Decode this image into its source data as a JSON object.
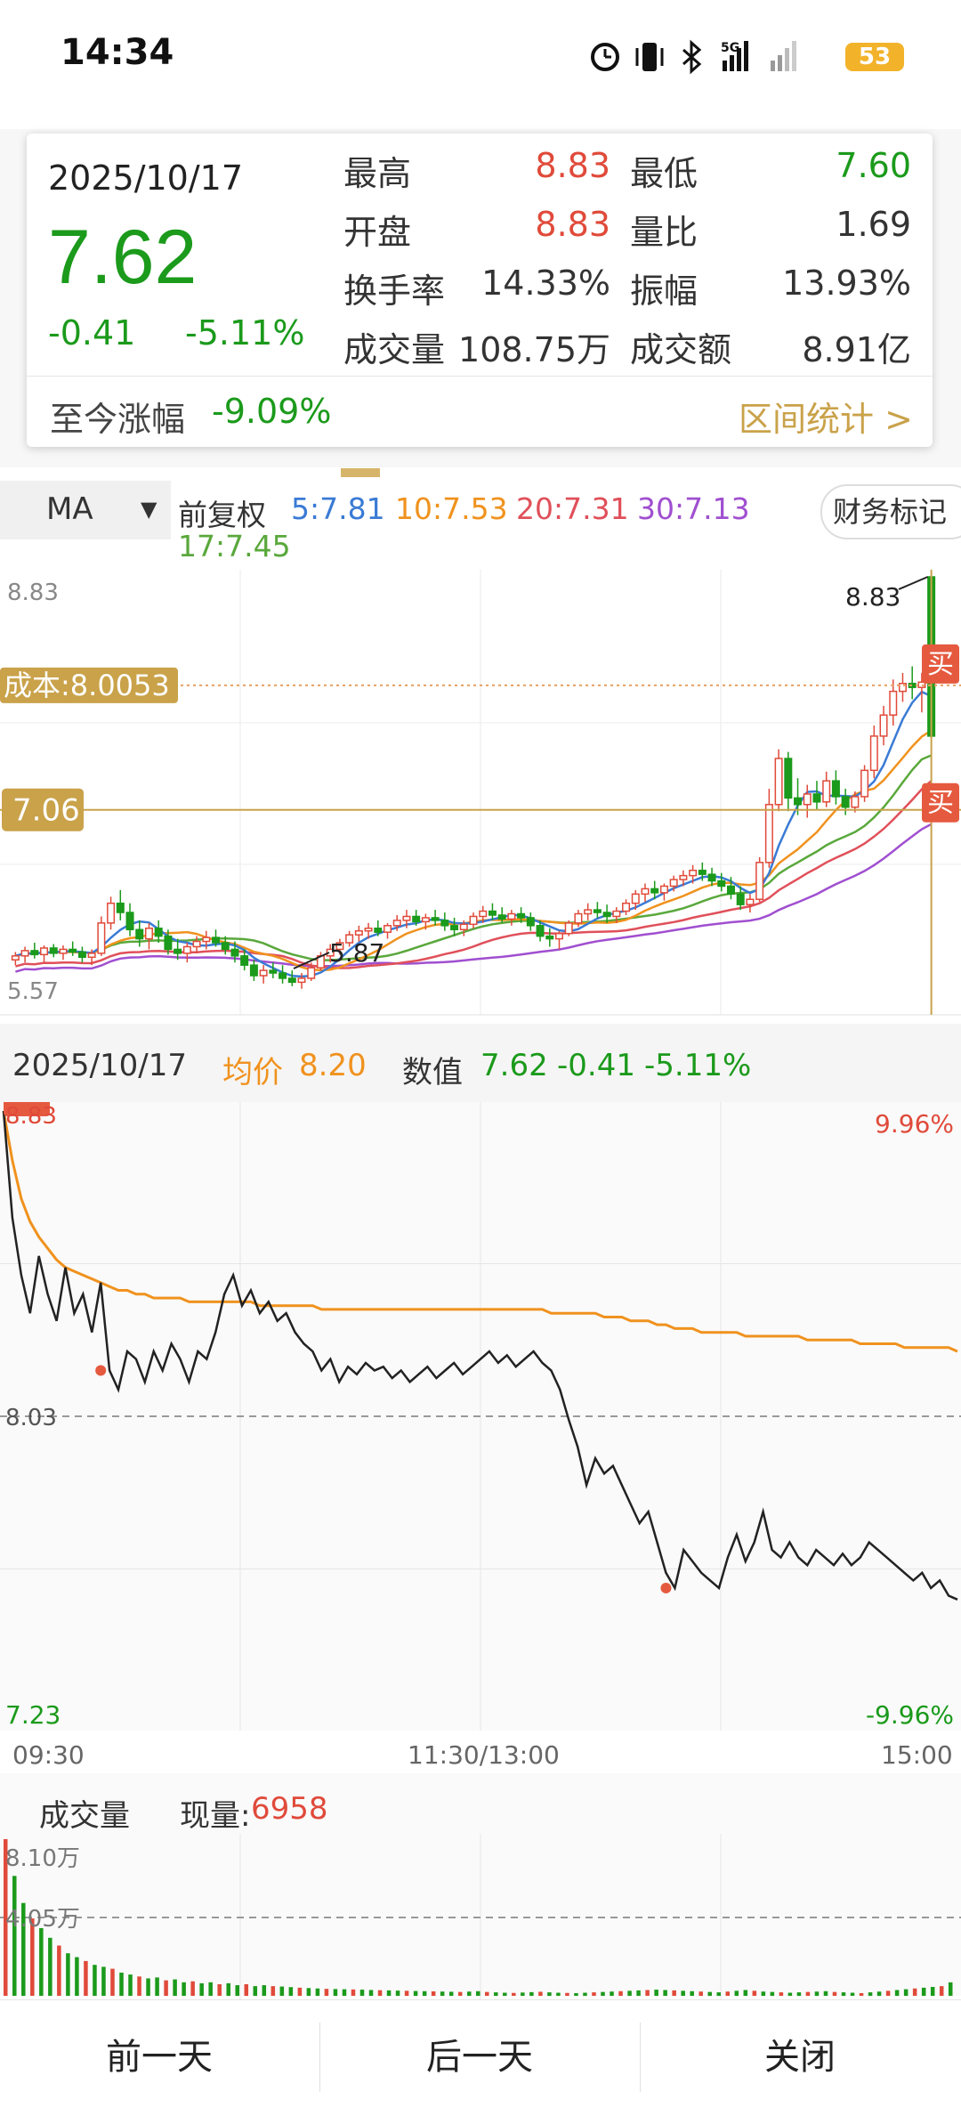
{
  "status_bar": {
    "time": "14:34",
    "battery": "53",
    "icons": [
      "alarm-icon",
      "vibrate-icon",
      "bluetooth-icon",
      "5g-signal-icon",
      "signal-icon",
      "battery-icon"
    ]
  },
  "popup": {
    "date": "2025/10/17",
    "price": "7.62",
    "change": "-0.41",
    "change_pct": "-5.11%",
    "stats": [
      {
        "label": "最高",
        "value": "8.83",
        "color": "#e04a3a"
      },
      {
        "label": "最低",
        "value": "7.60",
        "color": "#1b9a1b"
      },
      {
        "label": "开盘",
        "value": "8.83",
        "color": "#e04a3a"
      },
      {
        "label": "量比",
        "value": "1.69",
        "color": "#333333"
      },
      {
        "label": "换手率",
        "value": "14.33%",
        "color": "#333333"
      },
      {
        "label": "振幅",
        "value": "13.93%",
        "color": "#333333"
      },
      {
        "label": "成交量",
        "value": "108.75万",
        "color": "#333333"
      },
      {
        "label": "成交额",
        "value": "8.91亿",
        "color": "#333333"
      }
    ],
    "ytd_label": "至今涨幅",
    "ytd_value": "-9.09%",
    "range_stats": "区间统计 >"
  },
  "ma_bar": {
    "selector": "MA",
    "adjust": "前复权",
    "items": [
      {
        "text": "5:7.81",
        "color": "#3a7bd5"
      },
      {
        "text": "10:7.53",
        "color": "#f0921e"
      },
      {
        "text": "20:7.31",
        "color": "#e0505a"
      },
      {
        "text": "30:7.13",
        "color": "#a04fd0"
      },
      {
        "text": "17:7.45",
        "color": "#5aa83c"
      }
    ],
    "finance_mark": "财务标记"
  },
  "chart_data": [
    {
      "type": "candlestick",
      "title": "",
      "y_labels": {
        "top": "8.83",
        "bottom": "5.57"
      },
      "ylim": [
        5.57,
        8.83
      ],
      "high_marker": "8.83",
      "low_marker": "5.87",
      "cost_line": {
        "label": "成本:8.0053",
        "value": 8.0053
      },
      "price_line": {
        "label": "7.06",
        "value": 7.06
      },
      "buy_markers": [
        "买",
        "买"
      ],
      "candles": [
        [
          5.92,
          5.98,
          5.88,
          5.95
        ],
        [
          5.95,
          6.02,
          5.9,
          5.99
        ],
        [
          5.99,
          6.05,
          5.93,
          5.96
        ],
        [
          5.96,
          6.03,
          5.9,
          6.01
        ],
        [
          6.01,
          6.04,
          5.94,
          5.97
        ],
        [
          5.97,
          6.03,
          5.92,
          6.0
        ],
        [
          6.0,
          6.06,
          5.95,
          5.98
        ],
        [
          5.98,
          6.02,
          5.9,
          5.94
        ],
        [
          5.94,
          6.0,
          5.88,
          5.97
        ],
        [
          5.97,
          6.25,
          5.95,
          6.2
        ],
        [
          6.2,
          6.4,
          6.15,
          6.35
        ],
        [
          6.35,
          6.45,
          6.22,
          6.28
        ],
        [
          6.28,
          6.35,
          6.1,
          6.15
        ],
        [
          6.15,
          6.22,
          6.02,
          6.08
        ],
        [
          6.08,
          6.2,
          6.0,
          6.16
        ],
        [
          6.16,
          6.22,
          6.05,
          6.1
        ],
        [
          6.1,
          6.15,
          5.96,
          6.0
        ],
        [
          6.0,
          6.08,
          5.92,
          5.97
        ],
        [
          5.97,
          6.05,
          5.9,
          6.02
        ],
        [
          6.02,
          6.1,
          5.97,
          6.06
        ],
        [
          6.06,
          6.14,
          6.0,
          6.09
        ],
        [
          6.09,
          6.15,
          6.02,
          6.05
        ],
        [
          6.05,
          6.1,
          5.96,
          6.0
        ],
        [
          6.0,
          6.06,
          5.9,
          5.95
        ],
        [
          5.95,
          6.0,
          5.84,
          5.88
        ],
        [
          5.88,
          5.92,
          5.76,
          5.8
        ],
        [
          5.8,
          5.88,
          5.74,
          5.84
        ],
        [
          5.84,
          5.9,
          5.78,
          5.82
        ],
        [
          5.82,
          5.88,
          5.74,
          5.78
        ],
        [
          5.78,
          5.84,
          5.72,
          5.75
        ],
        [
          5.75,
          5.82,
          5.7,
          5.78
        ],
        [
          5.78,
          5.9,
          5.76,
          5.86
        ],
        [
          5.86,
          5.98,
          5.84,
          5.95
        ],
        [
          5.95,
          6.04,
          5.9,
          6.0
        ],
        [
          6.0,
          6.08,
          5.96,
          6.05
        ],
        [
          6.05,
          6.14,
          6.02,
          6.11
        ],
        [
          6.11,
          6.18,
          6.06,
          6.14
        ],
        [
          6.14,
          6.2,
          6.08,
          6.16
        ],
        [
          6.16,
          6.22,
          6.1,
          6.13
        ],
        [
          6.13,
          6.2,
          6.08,
          6.18
        ],
        [
          6.18,
          6.26,
          6.14,
          6.22
        ],
        [
          6.22,
          6.3,
          6.16,
          6.25
        ],
        [
          6.25,
          6.3,
          6.18,
          6.21
        ],
        [
          6.21,
          6.27,
          6.15,
          6.24
        ],
        [
          6.24,
          6.3,
          6.18,
          6.22
        ],
        [
          6.22,
          6.28,
          6.14,
          6.18
        ],
        [
          6.18,
          6.24,
          6.1,
          6.15
        ],
        [
          6.15,
          6.22,
          6.1,
          6.19
        ],
        [
          6.19,
          6.28,
          6.16,
          6.25
        ],
        [
          6.25,
          6.33,
          6.2,
          6.29
        ],
        [
          6.29,
          6.35,
          6.22,
          6.26
        ],
        [
          6.26,
          6.32,
          6.2,
          6.23
        ],
        [
          6.23,
          6.3,
          6.18,
          6.27
        ],
        [
          6.27,
          6.32,
          6.2,
          6.24
        ],
        [
          6.24,
          6.28,
          6.14,
          6.18
        ],
        [
          6.18,
          6.22,
          6.06,
          6.1
        ],
        [
          6.1,
          6.16,
          6.02,
          6.08
        ],
        [
          6.08,
          6.14,
          6.0,
          6.12
        ],
        [
          6.12,
          6.22,
          6.1,
          6.2
        ],
        [
          6.2,
          6.3,
          6.17,
          6.27
        ],
        [
          6.27,
          6.35,
          6.22,
          6.3
        ],
        [
          6.3,
          6.36,
          6.24,
          6.28
        ],
        [
          6.28,
          6.34,
          6.2,
          6.25
        ],
        [
          6.25,
          6.32,
          6.2,
          6.29
        ],
        [
          6.29,
          6.38,
          6.26,
          6.35
        ],
        [
          6.35,
          6.45,
          6.3,
          6.42
        ],
        [
          6.42,
          6.5,
          6.36,
          6.46
        ],
        [
          6.46,
          6.52,
          6.38,
          6.43
        ],
        [
          6.43,
          6.5,
          6.37,
          6.48
        ],
        [
          6.48,
          6.56,
          6.44,
          6.53
        ],
        [
          6.53,
          6.6,
          6.48,
          6.56
        ],
        [
          6.56,
          6.64,
          6.5,
          6.6
        ],
        [
          6.6,
          6.66,
          6.52,
          6.57
        ],
        [
          6.57,
          6.62,
          6.48,
          6.52
        ],
        [
          6.52,
          6.58,
          6.44,
          6.48
        ],
        [
          6.48,
          6.55,
          6.38,
          6.42
        ],
        [
          6.42,
          6.48,
          6.3,
          6.34
        ],
        [
          6.34,
          6.42,
          6.28,
          6.38
        ],
        [
          6.38,
          6.7,
          6.36,
          6.66
        ],
        [
          6.66,
          7.22,
          6.62,
          7.1
        ],
        [
          7.1,
          7.52,
          7.05,
          7.45
        ],
        [
          7.45,
          7.5,
          7.05,
          7.15
        ],
        [
          7.15,
          7.3,
          7.02,
          7.1
        ],
        [
          7.1,
          7.25,
          7.0,
          7.18
        ],
        [
          7.18,
          7.28,
          7.06,
          7.12
        ],
        [
          7.12,
          7.35,
          7.08,
          7.28
        ],
        [
          7.28,
          7.36,
          7.1,
          7.16
        ],
        [
          7.16,
          7.22,
          7.02,
          7.08
        ],
        [
          7.08,
          7.2,
          7.04,
          7.16
        ],
        [
          7.16,
          7.4,
          7.12,
          7.36
        ],
        [
          7.36,
          7.7,
          7.3,
          7.62
        ],
        [
          7.62,
          7.85,
          7.55,
          7.78
        ],
        [
          7.78,
          8.05,
          7.7,
          7.96
        ],
        [
          7.96,
          8.1,
          7.88,
          8.02
        ],
        [
          8.02,
          8.15,
          7.9,
          7.99
        ],
        [
          7.99,
          8.1,
          7.8,
          8.03
        ],
        [
          8.83,
          8.83,
          7.6,
          7.62
        ]
      ]
    },
    {
      "type": "line",
      "title": "",
      "date": "2025/10/17",
      "avg_label": "均价",
      "avg_value": "8.20",
      "value_label": "数值",
      "value": "7.62",
      "change": "-0.41",
      "change_pct": "-5.11%",
      "y_labels": {
        "top": "8.83",
        "mid": "8.03",
        "bottom": "7.23",
        "top_pct": "9.96%",
        "bottom_pct": "-9.96%"
      },
      "ylim": [
        7.23,
        8.83
      ],
      "x_labels": [
        "09:30",
        "11:30/13:00",
        "15:00"
      ],
      "price": [
        8.83,
        8.55,
        8.4,
        8.3,
        8.45,
        8.35,
        8.28,
        8.42,
        8.3,
        8.35,
        8.25,
        8.38,
        8.15,
        8.1,
        8.2,
        8.18,
        8.12,
        8.2,
        8.15,
        8.22,
        8.18,
        8.12,
        8.2,
        8.18,
        8.25,
        8.35,
        8.4,
        8.32,
        8.36,
        8.3,
        8.33,
        8.28,
        8.3,
        8.25,
        8.22,
        8.2,
        8.15,
        8.18,
        8.12,
        8.16,
        8.14,
        8.17,
        8.15,
        8.16,
        8.13,
        8.15,
        8.12,
        8.14,
        8.16,
        8.13,
        8.15,
        8.17,
        8.14,
        8.16,
        8.18,
        8.2,
        8.17,
        8.19,
        8.16,
        8.18,
        8.2,
        8.17,
        8.15,
        8.1,
        8.02,
        7.95,
        7.85,
        7.92,
        7.88,
        7.9,
        7.85,
        7.8,
        7.75,
        7.78,
        7.7,
        7.62,
        7.58,
        7.68,
        7.65,
        7.62,
        7.6,
        7.58,
        7.66,
        7.72,
        7.65,
        7.7,
        7.78,
        7.68,
        7.66,
        7.7,
        7.66,
        7.64,
        7.68,
        7.66,
        7.64,
        7.67,
        7.64,
        7.66,
        7.7,
        7.68,
        7.66,
        7.64,
        7.62,
        7.6,
        7.62,
        7.58,
        7.6,
        7.56,
        7.55
      ],
      "avg": [
        8.83,
        8.7,
        8.6,
        8.54,
        8.5,
        8.47,
        8.44,
        8.42,
        8.41,
        8.4,
        8.39,
        8.38,
        8.37,
        8.36,
        8.36,
        8.35,
        8.35,
        8.34,
        8.34,
        8.34,
        8.34,
        8.33,
        8.33,
        8.33,
        8.33,
        8.33,
        8.33,
        8.33,
        8.33,
        8.32,
        8.32,
        8.32,
        8.32,
        8.32,
        8.32,
        8.32,
        8.31,
        8.31,
        8.31,
        8.31,
        8.31,
        8.31,
        8.31,
        8.31,
        8.31,
        8.31,
        8.31,
        8.31,
        8.31,
        8.31,
        8.31,
        8.31,
        8.31,
        8.31,
        8.31,
        8.31,
        8.31,
        8.31,
        8.31,
        8.31,
        8.31,
        8.31,
        8.3,
        8.3,
        8.3,
        8.3,
        8.3,
        8.3,
        8.29,
        8.29,
        8.29,
        8.28,
        8.28,
        8.28,
        8.27,
        8.27,
        8.26,
        8.26,
        8.26,
        8.25,
        8.25,
        8.25,
        8.25,
        8.25,
        8.24,
        8.24,
        8.24,
        8.24,
        8.24,
        8.24,
        8.24,
        8.23,
        8.23,
        8.23,
        8.23,
        8.23,
        8.23,
        8.22,
        8.22,
        8.22,
        8.22,
        8.22,
        8.21,
        8.21,
        8.21,
        8.21,
        8.21,
        8.21,
        8.2
      ]
    },
    {
      "type": "bar",
      "title": "成交量",
      "current_label": "现量:",
      "current_value": "6958",
      "y_labels": {
        "top": "8.10万",
        "mid": "4.05万"
      },
      "ylim": [
        0,
        81000
      ],
      "values": [
        81000,
        62000,
        48000,
        40000,
        35000,
        30000,
        26000,
        22000,
        20000,
        18000,
        16000,
        15000,
        14000,
        12000,
        11000,
        10000,
        9000,
        9500,
        8000,
        8500,
        7000,
        7500,
        6500,
        7000,
        6000,
        6500,
        5500,
        6000,
        5000,
        5500,
        5000,
        4800,
        4500,
        4200,
        4000,
        3800,
        3600,
        3500,
        3400,
        3300,
        3200,
        3000,
        2900,
        2800,
        2700,
        2600,
        2500,
        2400,
        2300,
        2200,
        2100,
        2000,
        2200,
        2400,
        2000,
        1800,
        1600,
        1500,
        1700,
        1900,
        2100,
        1800,
        1600,
        1500,
        1400,
        1600,
        1800,
        2000,
        2200,
        2400,
        2600,
        2800,
        3000,
        3200,
        3000,
        2800,
        2600,
        2400,
        2200,
        2000,
        1800,
        2200,
        2600,
        3000,
        2600,
        2200,
        2000,
        1800,
        1600,
        1800,
        2000,
        2200,
        2400,
        2000,
        1800,
        1600,
        1400,
        1800,
        2200,
        2600,
        3000,
        3400,
        3800,
        4200,
        4600,
        5000,
        6958
      ]
    }
  ],
  "bottom_bar": {
    "prev": "前一天",
    "next": "后一天",
    "close": "关闭"
  },
  "colors": {
    "up": "#e04a3a",
    "down": "#1b9a1b",
    "gold": "#c9a24a",
    "avg_line": "#f0921e"
  }
}
